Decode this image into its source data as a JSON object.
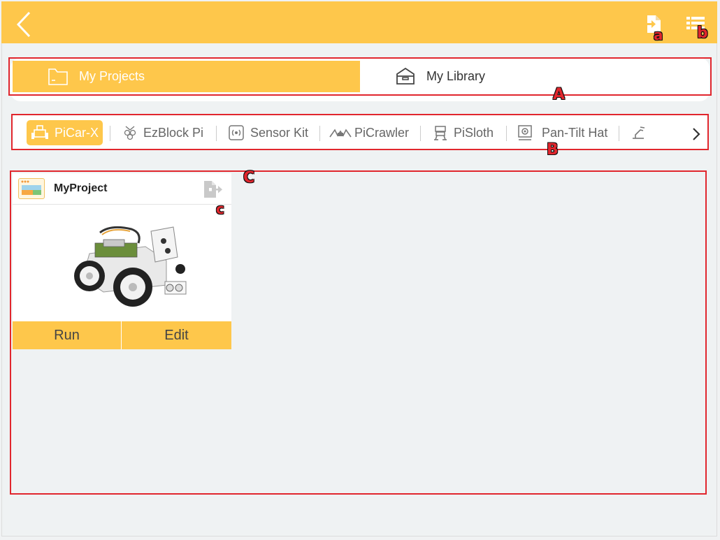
{
  "colors": {
    "accent": "#fec74b",
    "annotation": "#e1262d",
    "background": "#eff2f3"
  },
  "toolbar": {
    "back_icon": "back-chevron-icon",
    "import_icon": "import-file-icon",
    "menu_icon": "list-menu-icon"
  },
  "annotations": {
    "a": "a",
    "b": "b",
    "A": "A",
    "B": "B",
    "C": "C",
    "c": "c"
  },
  "tabs": [
    {
      "label": "My Projects",
      "icon": "folder-icon",
      "active": true
    },
    {
      "label": "My Library",
      "icon": "library-box-icon",
      "active": false
    }
  ],
  "products": [
    {
      "label": "PiCar-X",
      "icon": "picar-x-icon",
      "active": true
    },
    {
      "label": "EzBlock Pi",
      "icon": "raspberry-pi-icon",
      "active": false
    },
    {
      "label": "Sensor Kit",
      "icon": "sensor-icon",
      "active": false
    },
    {
      "label": "PiCrawler",
      "icon": "crawler-icon",
      "active": false
    },
    {
      "label": "PiSloth",
      "icon": "sloth-robot-icon",
      "active": false
    },
    {
      "label": "Pan-Tilt Hat",
      "icon": "camera-icon",
      "active": false
    },
    {
      "label": "",
      "icon": "robot-arm-icon",
      "active": false
    }
  ],
  "projects": [
    {
      "title": "MyProject",
      "image": "robot-car-photo",
      "run_label": "Run",
      "edit_label": "Edit"
    }
  ]
}
